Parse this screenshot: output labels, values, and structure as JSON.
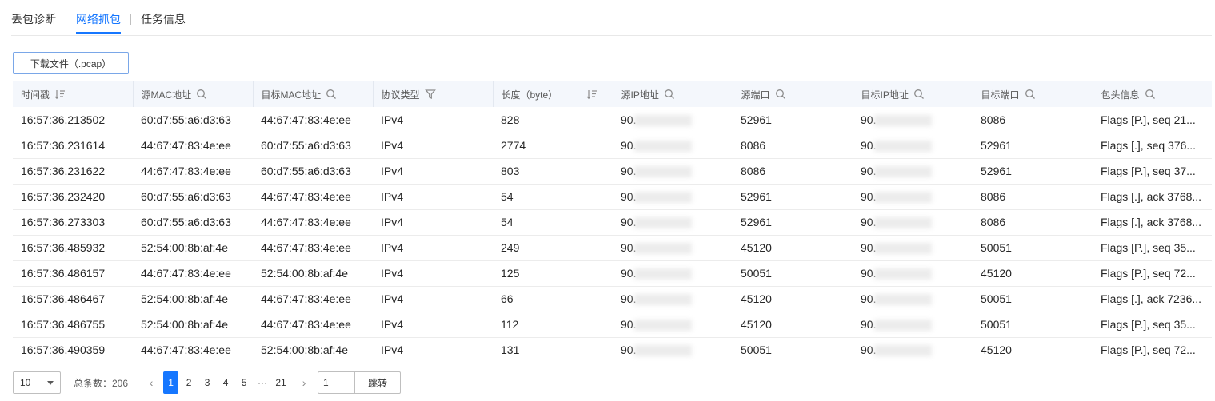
{
  "tabs": [
    {
      "label": "丢包诊断",
      "active": false
    },
    {
      "label": "网络抓包",
      "active": true
    },
    {
      "label": "任务信息",
      "active": false
    }
  ],
  "toolbar": {
    "download_label": "下载文件（.pcap）"
  },
  "table": {
    "columns": [
      "时间戳",
      "源MAC地址",
      "目标MAC地址",
      "协议类型",
      "长度（byte）",
      "源IP地址",
      "源端口",
      "目标IP地址",
      "目标端口",
      "包头信息"
    ],
    "column_icons": [
      "sort-icon",
      "search-icon",
      "search-icon",
      "filter-icon",
      "sort-icon",
      "search-icon",
      "search-icon",
      "search-icon",
      "search-icon",
      "search-icon"
    ],
    "rows": [
      [
        "16:57:36.213502",
        "60:d7:55:a6:d3:63",
        "44:67:47:83:4e:ee",
        "IPv4",
        "828",
        "90.",
        "52961",
        "90.",
        "8086",
        "Flags [P.], seq 21..."
      ],
      [
        "16:57:36.231614",
        "44:67:47:83:4e:ee",
        "60:d7:55:a6:d3:63",
        "IPv4",
        "2774",
        "90.",
        "8086",
        "90.",
        "52961",
        "Flags [.], seq 376..."
      ],
      [
        "16:57:36.231622",
        "44:67:47:83:4e:ee",
        "60:d7:55:a6:d3:63",
        "IPv4",
        "803",
        "90.",
        "8086",
        "90.",
        "52961",
        "Flags [P.], seq 37..."
      ],
      [
        "16:57:36.232420",
        "60:d7:55:a6:d3:63",
        "44:67:47:83:4e:ee",
        "IPv4",
        "54",
        "90.",
        "52961",
        "90.",
        "8086",
        "Flags [.], ack 3768..."
      ],
      [
        "16:57:36.273303",
        "60:d7:55:a6:d3:63",
        "44:67:47:83:4e:ee",
        "IPv4",
        "54",
        "90.",
        "52961",
        "90.",
        "8086",
        "Flags [.], ack 3768..."
      ],
      [
        "16:57:36.485932",
        "52:54:00:8b:af:4e",
        "44:67:47:83:4e:ee",
        "IPv4",
        "249",
        "90.",
        "45120",
        "90.",
        "50051",
        "Flags [P.], seq 35..."
      ],
      [
        "16:57:36.486157",
        "44:67:47:83:4e:ee",
        "52:54:00:8b:af:4e",
        "IPv4",
        "125",
        "90.",
        "50051",
        "90.",
        "45120",
        "Flags [P.], seq 72..."
      ],
      [
        "16:57:36.486467",
        "52:54:00:8b:af:4e",
        "44:67:47:83:4e:ee",
        "IPv4",
        "66",
        "90.",
        "45120",
        "90.",
        "50051",
        "Flags [.], ack 7236..."
      ],
      [
        "16:57:36.486755",
        "52:54:00:8b:af:4e",
        "44:67:47:83:4e:ee",
        "IPv4",
        "112",
        "90.",
        "45120",
        "90.",
        "50051",
        "Flags [P.], seq 35..."
      ],
      [
        "16:57:36.490359",
        "44:67:47:83:4e:ee",
        "52:54:00:8b:af:4e",
        "IPv4",
        "131",
        "90.",
        "50051",
        "90.",
        "45120",
        "Flags [P.], seq 72..."
      ]
    ]
  },
  "pagination": {
    "page_size": "10",
    "total_label": "总条数：206",
    "prev_icon": "chevron-left-icon",
    "next_icon": "chevron-right-icon",
    "pages": [
      "1",
      "2",
      "3",
      "4",
      "5",
      "···",
      "21"
    ],
    "current_page": "1",
    "jump_value": "1",
    "jump_label": "跳转"
  },
  "colors": {
    "accent": "#1677ff",
    "header_bg": "#f4f7fc"
  }
}
